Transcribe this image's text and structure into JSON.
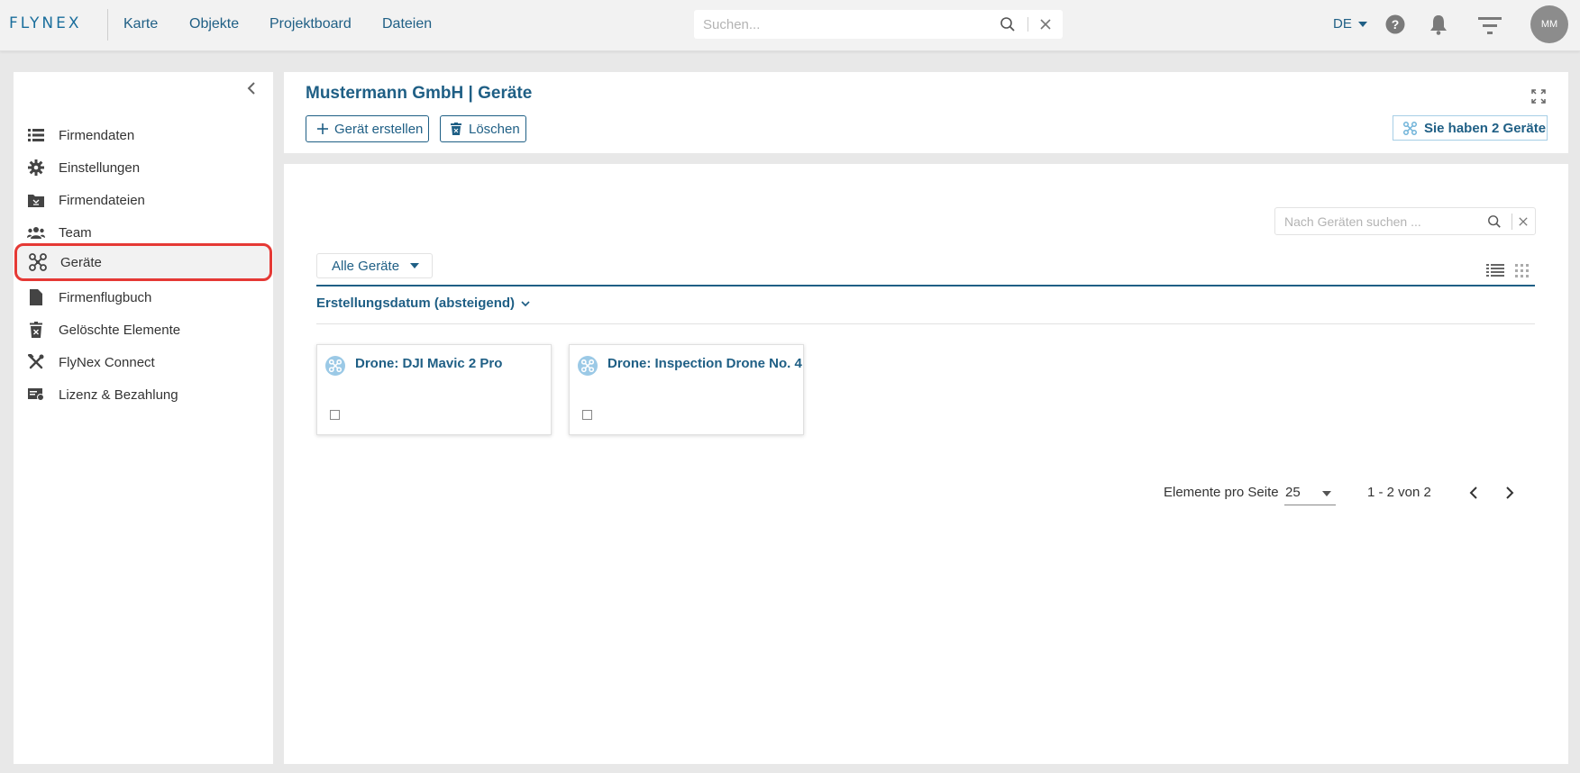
{
  "app": {
    "logo_text": "FLYNEX",
    "nav": [
      "Karte",
      "Objekte",
      "Projektboard",
      "Dateien"
    ],
    "search_placeholder": "Suchen...",
    "language": "DE",
    "user_initials": "MM"
  },
  "sidebar": {
    "items": [
      {
        "label": "Firmendaten",
        "icon": "list-icon"
      },
      {
        "label": "Einstellungen",
        "icon": "gear-icon"
      },
      {
        "label": "Firmendateien",
        "icon": "folder-icon"
      },
      {
        "label": "Team",
        "icon": "team-icon"
      },
      {
        "label": "Geräte",
        "icon": "drone-icon",
        "active": true
      },
      {
        "label": "Firmenflugbuch",
        "icon": "document-icon"
      },
      {
        "label": "Gelöschte Elemente",
        "icon": "trash-icon"
      },
      {
        "label": "FlyNex Connect",
        "icon": "tools-icon"
      },
      {
        "label": "Lizenz & Bezahlung",
        "icon": "license-icon"
      }
    ]
  },
  "header": {
    "title": "Mustermann GmbH | Geräte",
    "create_button": "Gerät erstellen",
    "delete_button": "Löschen",
    "info_button": "Sie haben 2 Geräte"
  },
  "main": {
    "search_placeholder": "Nach Geräten suchen ...",
    "filter_label": "Alle Geräte",
    "sort_label": "Erstellungsdatum (absteigend)",
    "cards": [
      {
        "title": "Drone: DJI Mavic 2 Pro"
      },
      {
        "title": "Drone: Inspection Drone No. 4"
      }
    ],
    "pager": {
      "label": "Elemente pro Seite",
      "page_size": "25",
      "range": "1 - 2 von 2"
    }
  },
  "colors": {
    "accent": "#1f5f85",
    "highlight": "#e53935",
    "drone_icon_bg": "#9bc9e6"
  }
}
